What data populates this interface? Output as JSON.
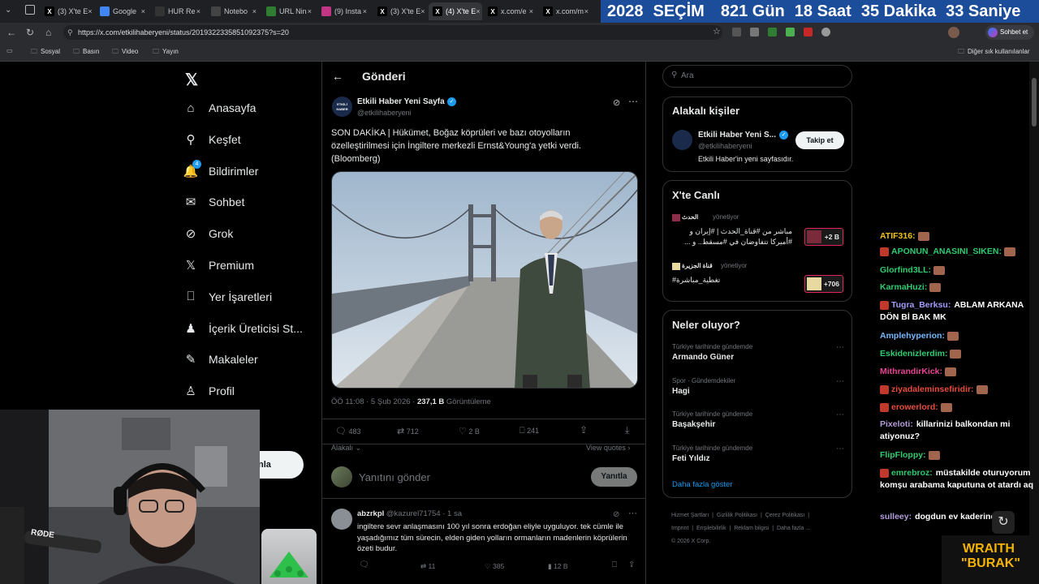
{
  "browser": {
    "tabs": [
      {
        "label": "(3) X'te E",
        "color": "#000000",
        "icon": "x-logo-icon"
      },
      {
        "label": "Google",
        "color": "#4285f4",
        "icon": "google-icon"
      },
      {
        "label": "HUR Re",
        "color": "#333333",
        "icon": "hur-icon"
      },
      {
        "label": "Notebo",
        "color": "#444444",
        "icon": "notebook-icon"
      },
      {
        "label": "URL Nin",
        "color": "#2e7d32",
        "icon": "url-icon"
      },
      {
        "label": "(9) Insta",
        "color": "#c13584",
        "icon": "instagram-icon"
      },
      {
        "label": "(3) X'te E",
        "color": "#000000",
        "icon": "x-logo-icon"
      },
      {
        "label": "(4) X'te E",
        "color": "#000000",
        "icon": "x-logo-icon"
      },
      {
        "label": "x.com/e",
        "color": "#000000",
        "icon": "x-logo-icon"
      },
      {
        "label": "x.com/m",
        "color": "#000000",
        "icon": "x-logo-icon"
      }
    ],
    "url": "https://x.com/etkilihaberyeni/status/2019322335851092375?s=20",
    "profile_button": "Sohbet et",
    "bookmarks": [
      "Sosyal",
      "Basın",
      "Video",
      "Yayın"
    ],
    "other_bookmarks": "Diğer sık kullanılanlar"
  },
  "countdown": {
    "year": "2028",
    "label": "SEÇİM",
    "days": "821 Gün",
    "hours": "18 Saat",
    "minutes": "35 Dakika",
    "seconds": "33 Saniye"
  },
  "nav": {
    "items": [
      {
        "label": "Anasayfa",
        "icon": "home-icon"
      },
      {
        "label": "Keşfet",
        "icon": "search-icon"
      },
      {
        "label": "Bildirimler",
        "icon": "bell-icon",
        "badge": "4"
      },
      {
        "label": "Sohbet",
        "icon": "mail-icon"
      },
      {
        "label": "Grok",
        "icon": "grok-icon"
      },
      {
        "label": "Premium",
        "icon": "x-logo-icon"
      },
      {
        "label": "Yer İşaretleri",
        "icon": "bookmark-icon"
      },
      {
        "label": "İçerik Üreticisi St...",
        "icon": "creator-icon"
      },
      {
        "label": "Makaleler",
        "icon": "article-icon"
      },
      {
        "label": "Profil",
        "icon": "person-icon"
      }
    ],
    "post_button_partial": "nla"
  },
  "post": {
    "header": "Gönderi",
    "author_name": "Etkili Haber Yeni Sayfa",
    "author_handle": "@etkilihaberyeni",
    "avatar_text": "ETKİLİ HABER",
    "text": "SON DAKİKA | Hükümet, Boğaz köprüleri ve bazı otoyolların özelleştirilmesi için İngiltere merkezli Ernst&Young'a yetki verdi. (Bloomberg)",
    "time": "ÖÖ 11:08 · 5 Şub 2026 ·",
    "views": "237,1 B",
    "views_label": "Görüntüleme",
    "stats": {
      "replies": "483",
      "reposts": "712",
      "likes": "2 B",
      "bookmarks": "241"
    },
    "related": "Alakalı",
    "view_quotes": "View quotes",
    "reply_placeholder": "Yanıtını gönder",
    "reply_button": "Yanıtla"
  },
  "reply": {
    "name": "abzrkpl",
    "handle": "@kazurel71754",
    "time": "· 1 sa",
    "text": "ingiltere sevr anlaşmasını 100 yıl sonra erdoğan eliyle uyguluyor. tek cümle ile yaşadığımız tüm sürecin, elden giden yolların ormanların madenlerin köprülerin özeti budur.",
    "stats": {
      "replies": "",
      "reposts": "11",
      "likes": "385",
      "views": "12 B"
    }
  },
  "right": {
    "search_placeholder": "Ara",
    "related_title": "Alakalı kişiler",
    "person": {
      "name": "Etkili Haber Yeni S...",
      "handle": "@etkilihaberyeni",
      "bio": "Etkili Haber'in yeni sayfasıdır.",
      "follow": "Takip et"
    },
    "live_title": "X'te Canlı",
    "live": [
      {
        "source": "الحدث",
        "status": "yönetiyor",
        "text": "مباشر من #قناة_الحدث | #إيران و #أميركا تتفاوضان في #مسقط.. و ...",
        "count": "+2 B"
      },
      {
        "source": "قناة الجزيرة",
        "status": "yönetiyor",
        "text": "#تغطية_مباشرة",
        "count": "+706"
      }
    ],
    "trends_title": "Neler oluyor?",
    "trends": [
      {
        "category": "Türkiye tarihinde gündemde",
        "name": "Armando Güner"
      },
      {
        "category": "Spor · Gündemdekiler",
        "name": "Hagi"
      },
      {
        "category": "Türkiye tarihinde gündemde",
        "name": "Başakşehir"
      },
      {
        "category": "Türkiye tarihinde gündemde",
        "name": "Feti Yıldız"
      }
    ],
    "show_more": "Daha fazla göster",
    "footer": [
      "Hizmet Şartları",
      "Gizlilik Politikası",
      "Çerez Politikası",
      "Imprint",
      "Erişilebilirlik",
      "Reklam bilgisi",
      "Daha fazla ...",
      "© 2026 X Corp."
    ]
  },
  "chat": [
    {
      "user": "ATIF316:",
      "color": "#f1c40f",
      "msg": ""
    },
    {
      "user": "APONUN_ANASINI_SIKEN:",
      "color": "#2ecc71",
      "msg": ""
    },
    {
      "user": "Glorfind3LL:",
      "color": "#2ecc71",
      "msg": ""
    },
    {
      "user": "KarmaHuzi:",
      "color": "#2ecc71",
      "msg": ""
    },
    {
      "user": "Tugra_Berksu:",
      "color": "#a29bfe",
      "msg": "ABLAM ARKANA DÖN Bİ BAK MK"
    },
    {
      "user": "Amplehyperion:",
      "color": "#74b9ff",
      "msg": ""
    },
    {
      "user": "Eskidenizlerdim:",
      "color": "#2ecc71",
      "msg": ""
    },
    {
      "user": "MithrandirKick:",
      "color": "#e84393",
      "msg": ""
    },
    {
      "user": "ziyadaleminsefiridir:",
      "color": "#e74c3c",
      "msg": ""
    },
    {
      "user": "erowerlord:",
      "color": "#e74c3c",
      "msg": ""
    },
    {
      "user": "Pixeloti:",
      "color": "#b39ddb",
      "msg": "killarinizi balkondan mi atiyonuz?"
    },
    {
      "user": "FlipFloppy:",
      "color": "#2ecc71",
      "msg": ""
    },
    {
      "user": "emrebroz:",
      "color": "#2ecc71",
      "msg": "müstakilde oturuyorum komşu arabama kaputuna ot atardı aq"
    },
    {
      "user": "sulleey:",
      "color": "#b39ddb",
      "msg": "dogdun ev kaderindir"
    }
  ],
  "webcam": {
    "mic_brand": "RØDE",
    "overlay_line1": "WRAITH",
    "overlay_line2": "\"BURAK\""
  },
  "colors": {
    "accent": "#1d9bf0",
    "countdown_bg": "#1b4d9a",
    "overlay_gold": "#f5b400"
  }
}
